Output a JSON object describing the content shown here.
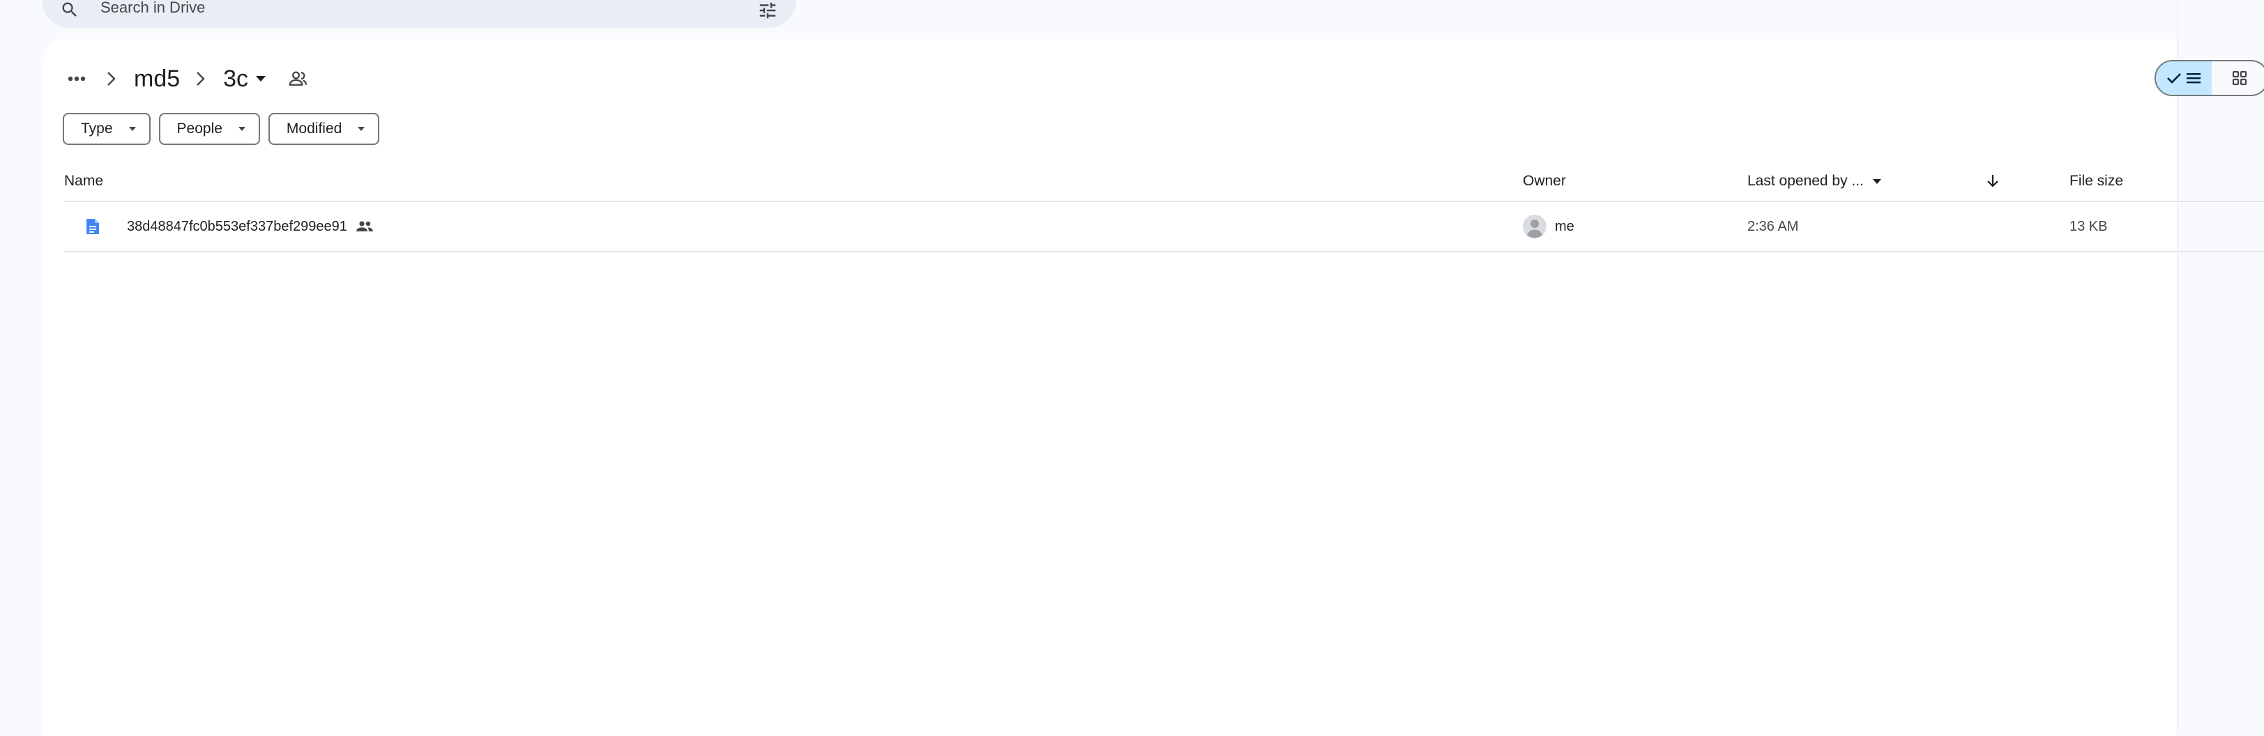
{
  "search": {
    "placeholder": "Search in Drive"
  },
  "breadcrumb": {
    "items": [
      "md5",
      "3c"
    ]
  },
  "filters": [
    "Type",
    "People",
    "Modified"
  ],
  "table": {
    "columns": {
      "name": "Name",
      "owner": "Owner",
      "last_opened": "Last opened by ...",
      "file_size": "File size"
    },
    "rows": [
      {
        "name": "38d48847fc0b553ef337bef299ee91",
        "owner": "me",
        "last_opened": "2:36 AM",
        "file_size": "13 KB"
      }
    ]
  },
  "colors": {
    "accent": "#0b57d0",
    "toggle_active": "#c2e7ff",
    "doc_icon": "#4285f4"
  },
  "icons": [
    "search-icon",
    "filter-icon",
    "help-icon",
    "settings-icon",
    "more-horiz-icon",
    "chevron-right-icon",
    "caret-down-icon",
    "shared-folder-icon",
    "check-icon",
    "list-icon",
    "grid-icon",
    "doc-icon",
    "people-icon",
    "avatar-icon",
    "arrow-down-icon"
  ]
}
